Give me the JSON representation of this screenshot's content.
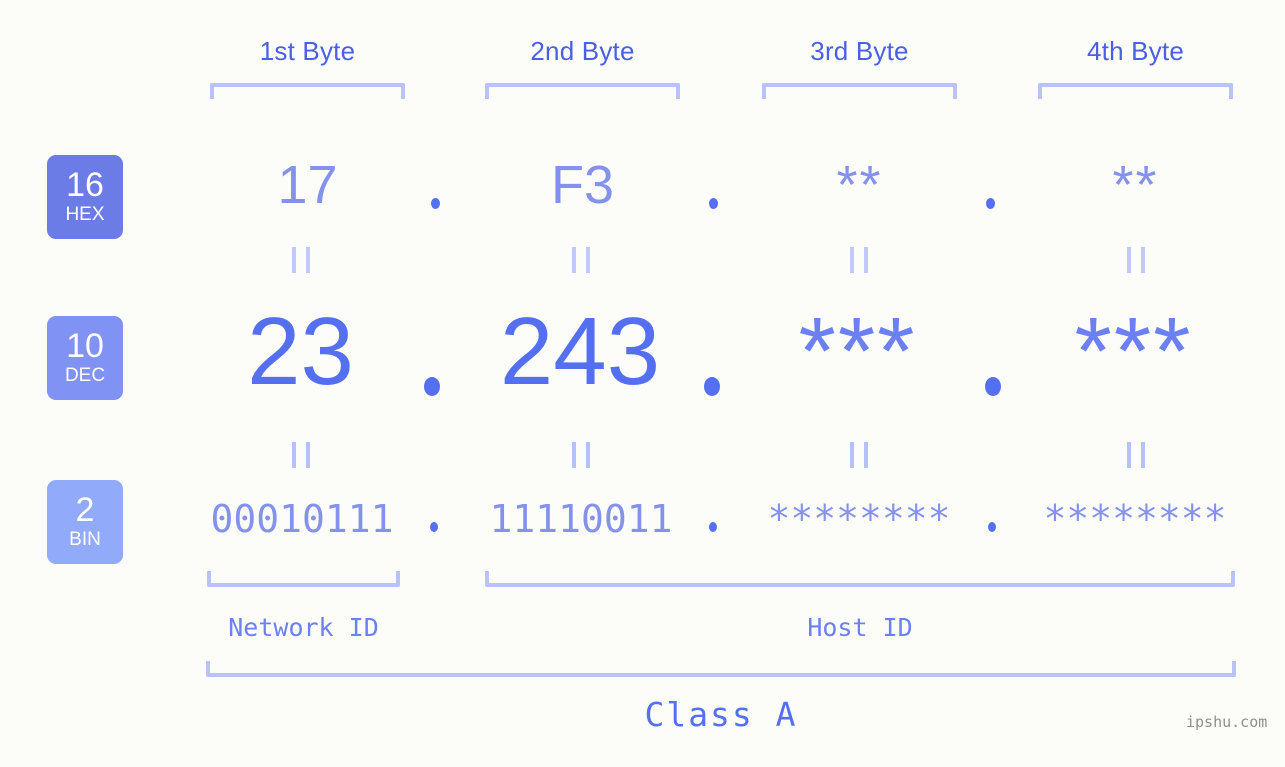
{
  "background_color": "#fcfdf8",
  "accent_colors": {
    "header_blue": "#4a5fe8",
    "bracket_lavender": "#b9c2fb",
    "hex_value": "#8492ee",
    "dec_value": "#5470f0",
    "bin_value": "#8492ee",
    "badge_hex": "#6c7ce6",
    "badge_dec": "#8192f5",
    "badge_bin": "#92aafa",
    "watermark": "#8f8f8f"
  },
  "byte_headers": [
    {
      "label": "1st Byte"
    },
    {
      "label": "2nd Byte"
    },
    {
      "label": "3rd Byte"
    },
    {
      "label": "4th Byte"
    }
  ],
  "radix_badges": [
    {
      "number": "16",
      "name": "HEX",
      "color": "#6c7ce6"
    },
    {
      "number": "10",
      "name": "DEC",
      "color": "#8192f5"
    },
    {
      "number": "2",
      "name": "BIN",
      "color": "#92aafa"
    }
  ],
  "rows": {
    "hex": {
      "values": [
        "17",
        "F3",
        "**",
        "**"
      ]
    },
    "dec": {
      "values": [
        "23",
        "243",
        "***",
        "***"
      ]
    },
    "bin": {
      "values": [
        "00010111",
        "11110011",
        "********",
        "********"
      ]
    }
  },
  "separator": ".",
  "equivalence_mark": "||",
  "id_groups": [
    {
      "label": "Network ID"
    },
    {
      "label": "Host ID"
    }
  ],
  "class": {
    "label": "Class A"
  },
  "watermark": {
    "text": "ipshu.com"
  }
}
